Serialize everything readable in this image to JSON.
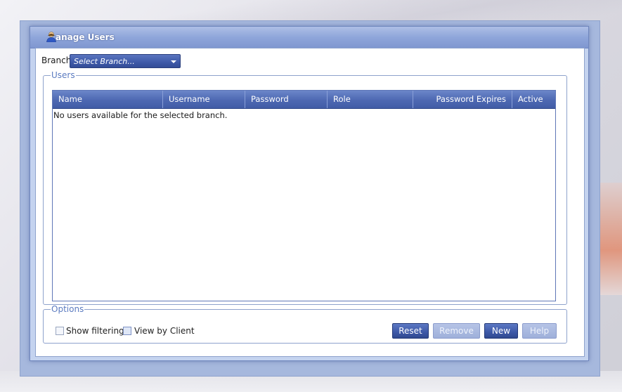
{
  "window": {
    "title": "anage Users"
  },
  "branch": {
    "label": "Branch",
    "selected": "Select Branch..."
  },
  "users_group": {
    "legend": "Users",
    "columns": [
      "Name",
      "Username",
      "Password",
      "Role",
      "Password Expires",
      "Active"
    ],
    "empty_message": "No users available for the selected branch."
  },
  "options_group": {
    "legend": "Options",
    "show_filtering_label": "Show filtering",
    "view_by_client_label": "View by Client",
    "buttons": {
      "reset": "Reset",
      "remove": "Remove",
      "new": "New",
      "help": "Help"
    }
  },
  "colors": {
    "accent": "#3d58a7",
    "legend": "#5b7bc0",
    "titlebar": "#8fa6da"
  }
}
